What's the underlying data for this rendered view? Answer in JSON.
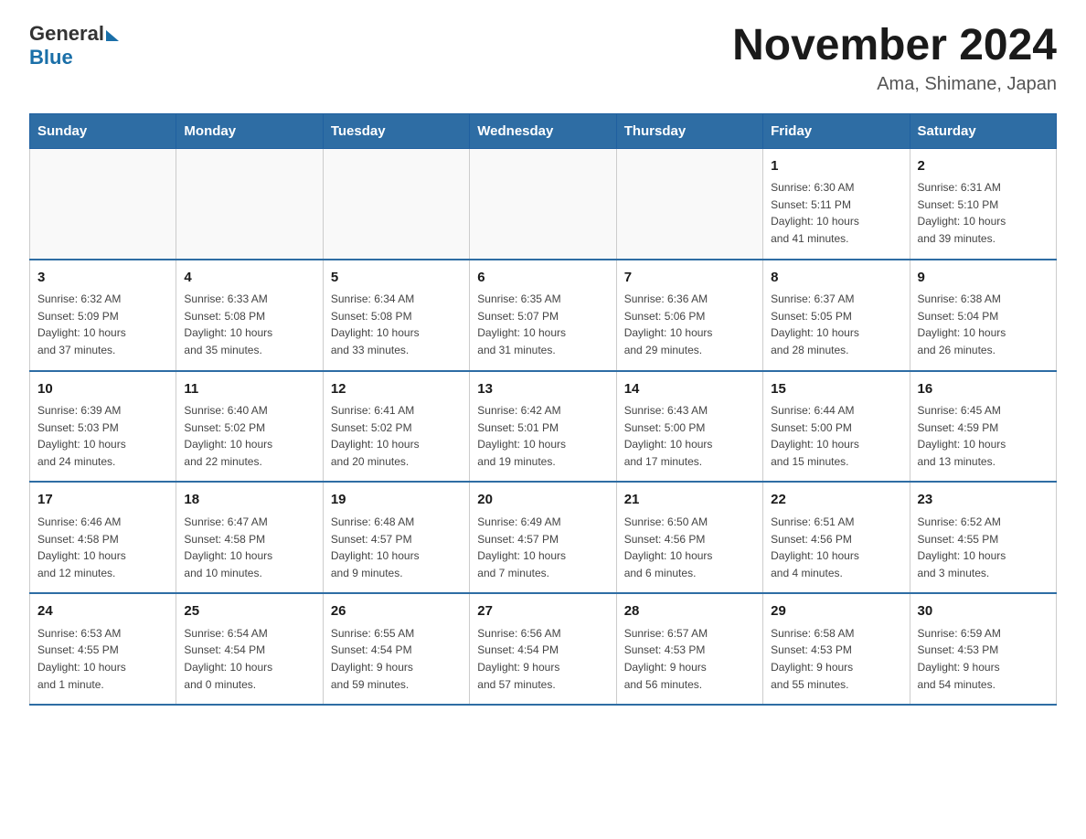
{
  "header": {
    "logo_general": "General",
    "logo_blue": "Blue",
    "month_title": "November 2024",
    "location": "Ama, Shimane, Japan"
  },
  "days_of_week": [
    "Sunday",
    "Monday",
    "Tuesday",
    "Wednesday",
    "Thursday",
    "Friday",
    "Saturday"
  ],
  "weeks": [
    [
      {
        "day": "",
        "info": ""
      },
      {
        "day": "",
        "info": ""
      },
      {
        "day": "",
        "info": ""
      },
      {
        "day": "",
        "info": ""
      },
      {
        "day": "",
        "info": ""
      },
      {
        "day": "1",
        "info": "Sunrise: 6:30 AM\nSunset: 5:11 PM\nDaylight: 10 hours\nand 41 minutes."
      },
      {
        "day": "2",
        "info": "Sunrise: 6:31 AM\nSunset: 5:10 PM\nDaylight: 10 hours\nand 39 minutes."
      }
    ],
    [
      {
        "day": "3",
        "info": "Sunrise: 6:32 AM\nSunset: 5:09 PM\nDaylight: 10 hours\nand 37 minutes."
      },
      {
        "day": "4",
        "info": "Sunrise: 6:33 AM\nSunset: 5:08 PM\nDaylight: 10 hours\nand 35 minutes."
      },
      {
        "day": "5",
        "info": "Sunrise: 6:34 AM\nSunset: 5:08 PM\nDaylight: 10 hours\nand 33 minutes."
      },
      {
        "day": "6",
        "info": "Sunrise: 6:35 AM\nSunset: 5:07 PM\nDaylight: 10 hours\nand 31 minutes."
      },
      {
        "day": "7",
        "info": "Sunrise: 6:36 AM\nSunset: 5:06 PM\nDaylight: 10 hours\nand 29 minutes."
      },
      {
        "day": "8",
        "info": "Sunrise: 6:37 AM\nSunset: 5:05 PM\nDaylight: 10 hours\nand 28 minutes."
      },
      {
        "day": "9",
        "info": "Sunrise: 6:38 AM\nSunset: 5:04 PM\nDaylight: 10 hours\nand 26 minutes."
      }
    ],
    [
      {
        "day": "10",
        "info": "Sunrise: 6:39 AM\nSunset: 5:03 PM\nDaylight: 10 hours\nand 24 minutes."
      },
      {
        "day": "11",
        "info": "Sunrise: 6:40 AM\nSunset: 5:02 PM\nDaylight: 10 hours\nand 22 minutes."
      },
      {
        "day": "12",
        "info": "Sunrise: 6:41 AM\nSunset: 5:02 PM\nDaylight: 10 hours\nand 20 minutes."
      },
      {
        "day": "13",
        "info": "Sunrise: 6:42 AM\nSunset: 5:01 PM\nDaylight: 10 hours\nand 19 minutes."
      },
      {
        "day": "14",
        "info": "Sunrise: 6:43 AM\nSunset: 5:00 PM\nDaylight: 10 hours\nand 17 minutes."
      },
      {
        "day": "15",
        "info": "Sunrise: 6:44 AM\nSunset: 5:00 PM\nDaylight: 10 hours\nand 15 minutes."
      },
      {
        "day": "16",
        "info": "Sunrise: 6:45 AM\nSunset: 4:59 PM\nDaylight: 10 hours\nand 13 minutes."
      }
    ],
    [
      {
        "day": "17",
        "info": "Sunrise: 6:46 AM\nSunset: 4:58 PM\nDaylight: 10 hours\nand 12 minutes."
      },
      {
        "day": "18",
        "info": "Sunrise: 6:47 AM\nSunset: 4:58 PM\nDaylight: 10 hours\nand 10 minutes."
      },
      {
        "day": "19",
        "info": "Sunrise: 6:48 AM\nSunset: 4:57 PM\nDaylight: 10 hours\nand 9 minutes."
      },
      {
        "day": "20",
        "info": "Sunrise: 6:49 AM\nSunset: 4:57 PM\nDaylight: 10 hours\nand 7 minutes."
      },
      {
        "day": "21",
        "info": "Sunrise: 6:50 AM\nSunset: 4:56 PM\nDaylight: 10 hours\nand 6 minutes."
      },
      {
        "day": "22",
        "info": "Sunrise: 6:51 AM\nSunset: 4:56 PM\nDaylight: 10 hours\nand 4 minutes."
      },
      {
        "day": "23",
        "info": "Sunrise: 6:52 AM\nSunset: 4:55 PM\nDaylight: 10 hours\nand 3 minutes."
      }
    ],
    [
      {
        "day": "24",
        "info": "Sunrise: 6:53 AM\nSunset: 4:55 PM\nDaylight: 10 hours\nand 1 minute."
      },
      {
        "day": "25",
        "info": "Sunrise: 6:54 AM\nSunset: 4:54 PM\nDaylight: 10 hours\nand 0 minutes."
      },
      {
        "day": "26",
        "info": "Sunrise: 6:55 AM\nSunset: 4:54 PM\nDaylight: 9 hours\nand 59 minutes."
      },
      {
        "day": "27",
        "info": "Sunrise: 6:56 AM\nSunset: 4:54 PM\nDaylight: 9 hours\nand 57 minutes."
      },
      {
        "day": "28",
        "info": "Sunrise: 6:57 AM\nSunset: 4:53 PM\nDaylight: 9 hours\nand 56 minutes."
      },
      {
        "day": "29",
        "info": "Sunrise: 6:58 AM\nSunset: 4:53 PM\nDaylight: 9 hours\nand 55 minutes."
      },
      {
        "day": "30",
        "info": "Sunrise: 6:59 AM\nSunset: 4:53 PM\nDaylight: 9 hours\nand 54 minutes."
      }
    ]
  ]
}
